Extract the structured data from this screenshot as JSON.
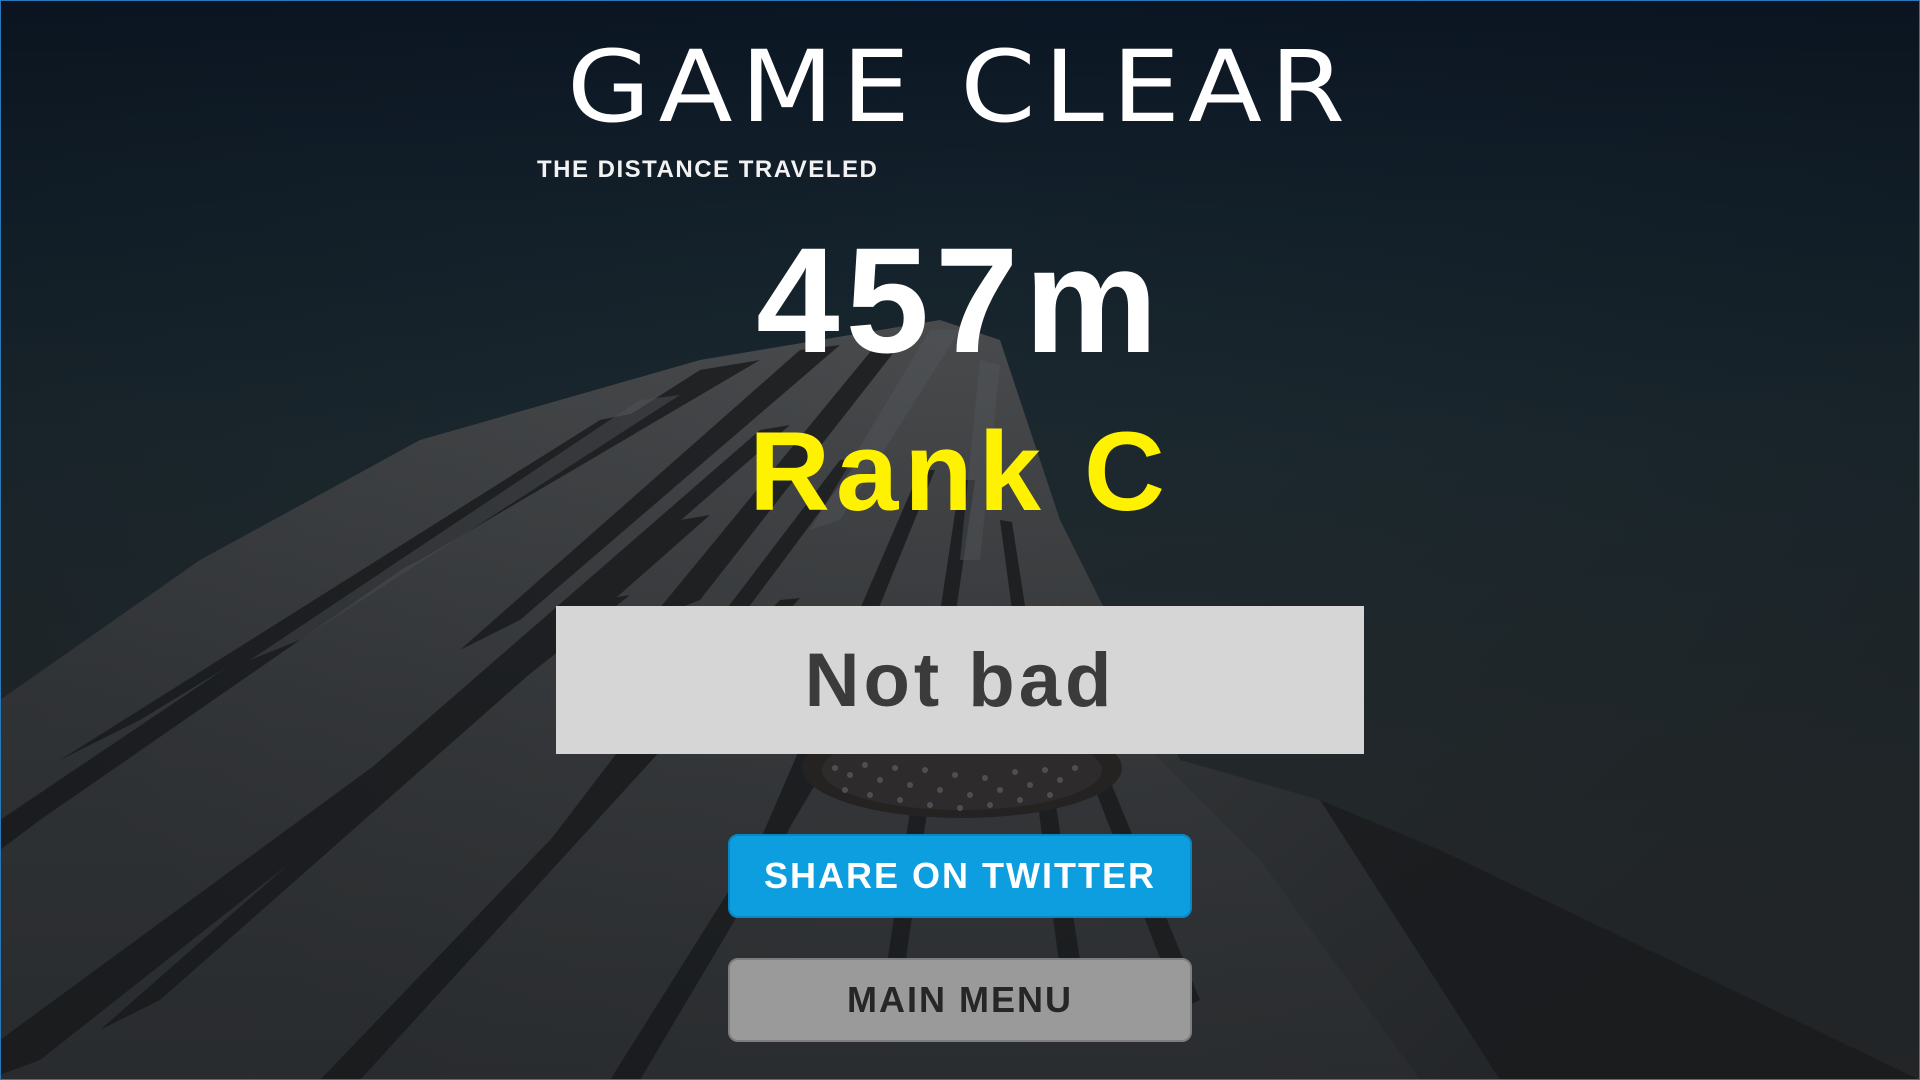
{
  "screen": {
    "title": "GAME CLEAR",
    "distance_label": "THE DISTANCE TRAVELED",
    "distance_value": "457m",
    "rank": "Rank C",
    "comment": "Not bad"
  },
  "buttons": {
    "share_label": "SHARE ON TWITTER",
    "main_menu_label": "MAIN MENU"
  },
  "colors": {
    "rank_text": "#fff200",
    "share_button": "#0d9ee0",
    "main_menu_button": "#9a9a9a",
    "comment_box": "#d6d6d6"
  }
}
